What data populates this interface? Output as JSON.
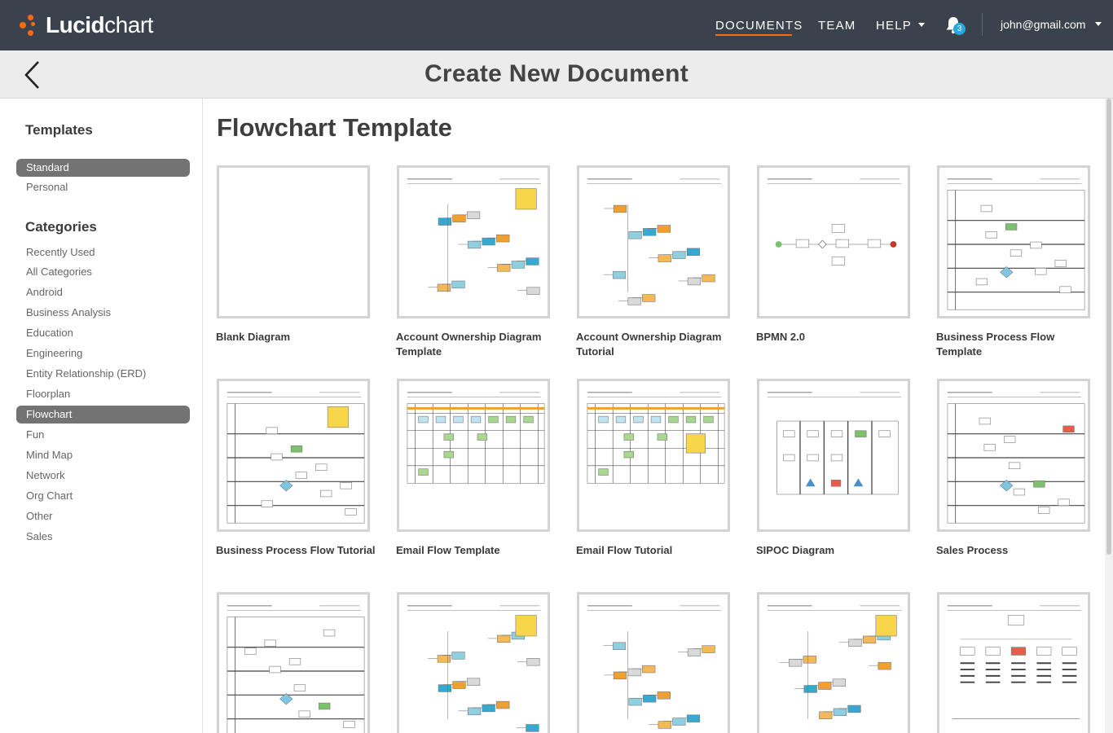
{
  "app": {
    "brand_bold": "Lucid",
    "brand_light": "chart",
    "accent": "#f96b13"
  },
  "nav": {
    "documents": "DOCUMENTS",
    "team": "TEAM",
    "help": "HELP",
    "notifications": "3",
    "user": "john@gmail.com"
  },
  "header": {
    "title": "Create New Document"
  },
  "sidebar": {
    "templates_heading": "Templates",
    "template_types": [
      "Standard",
      "Personal"
    ],
    "categories_heading": "Categories",
    "categories": [
      "Recently Used",
      "All Categories",
      "Android",
      "Business Analysis",
      "Education",
      "Engineering",
      "Entity Relationship (ERD)",
      "Floorplan",
      "Flowchart",
      "Fun",
      "Mind Map",
      "Network",
      "Org Chart",
      "Other",
      "Sales"
    ]
  },
  "main": {
    "section_title": "Flowchart Template",
    "templates": [
      {
        "label": "Blank Diagram",
        "icon": "blank-thumbnail"
      },
      {
        "label": "Account Ownership Diagram Template",
        "icon": "flowchart-thumbnail"
      },
      {
        "label": "Account Ownership Diagram Tutorial",
        "icon": "flowchart-thumbnail"
      },
      {
        "label": "BPMN 2.0",
        "icon": "bpmn-thumbnail"
      },
      {
        "label": "Business Process Flow Template",
        "icon": "swimlane-thumbnail"
      },
      {
        "label": "Business Process Flow Tutorial",
        "icon": "swimlane-thumbnail"
      },
      {
        "label": "Email Flow Template",
        "icon": "table-flow-thumbnail"
      },
      {
        "label": "Email Flow Tutorial",
        "icon": "table-flow-thumbnail"
      },
      {
        "label": "SIPOC Diagram",
        "icon": "sipoc-thumbnail"
      },
      {
        "label": "Sales Process",
        "icon": "swimlane-thumbnail"
      },
      {
        "label": "",
        "icon": "swimlane-thumbnail"
      },
      {
        "label": "",
        "icon": "flowchart-thumbnail"
      },
      {
        "label": "",
        "icon": "flowchart-thumbnail"
      },
      {
        "label": "",
        "icon": "flowchart-thumbnail"
      },
      {
        "label": "",
        "icon": "value-stream-thumbnail"
      }
    ]
  }
}
